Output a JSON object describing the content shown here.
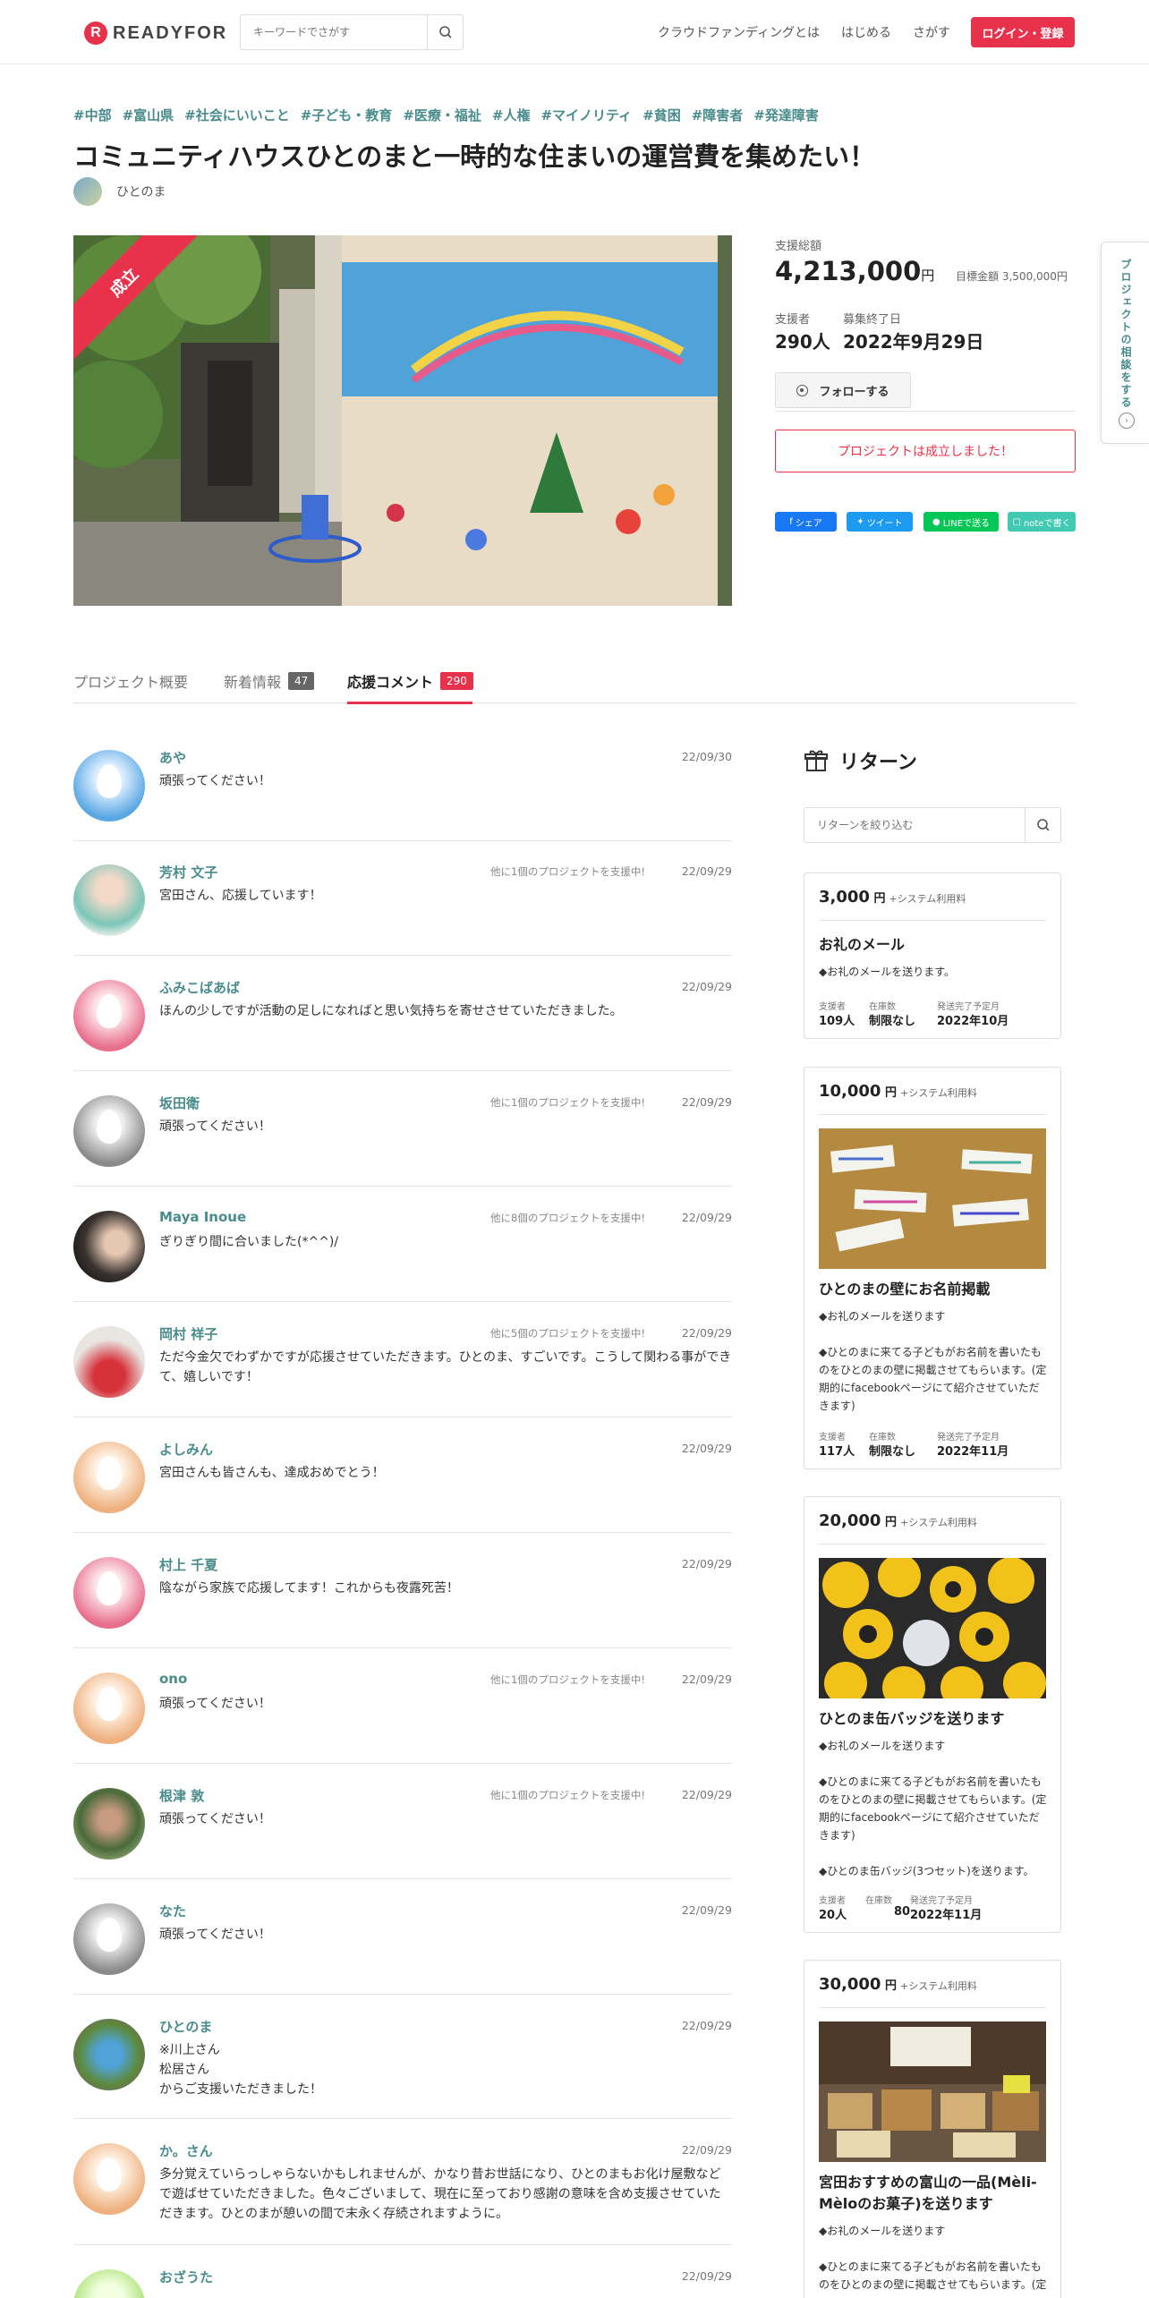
{
  "header": {
    "logo_text": "READYFOR",
    "search_placeholder": "キーワードでさがす",
    "nav": [
      "クラウドファンディングとは",
      "はじめる",
      "さがす"
    ],
    "login_label": "ログイン・登録"
  },
  "project": {
    "tags": [
      "#中部",
      "#富山県",
      "#社会にいいこと",
      "#子ども・教育",
      "#医療・福祉",
      "#人権",
      "#マイノリティ",
      "#貧困",
      "#障害者",
      "#発達障害"
    ],
    "title": "コミュニティハウスひとのまと一時的な住まいの運営費を集めたい！",
    "owner": "ひとのま",
    "ribbon": "成立"
  },
  "stats": {
    "total_label": "支援総額",
    "total_value": "4,213,000",
    "total_unit": "円",
    "goal_label": "目標金額",
    "goal_value": "3,500,000円",
    "supporters_label": "支援者",
    "supporters_value": "290人",
    "end_label": "募集終了日",
    "end_value": "2022年9月29日",
    "follow_label": "フォローする",
    "success_label": "プロジェクトは成立しました！",
    "share": [
      "シェア",
      "ツイート",
      "LINEで送る",
      "noteで書く"
    ]
  },
  "side_tab": {
    "label": "プロジェクトの相談をする"
  },
  "tabs": [
    {
      "label": "プロジェクト概要",
      "count": ""
    },
    {
      "label": "新着情報",
      "count": "47"
    },
    {
      "label": "応援コメント",
      "count": "290"
    }
  ],
  "comments": [
    {
      "name": "あや",
      "other": "",
      "date": "22/09/30",
      "text": "頑張ってください！"
    },
    {
      "name": "芳村 文子",
      "other": "他に1個のプロジェクトを支援中!",
      "date": "22/09/29",
      "text": "宮田さん、応援しています！"
    },
    {
      "name": "ふみこばあば",
      "other": "",
      "date": "22/09/29",
      "text": "ほんの少しですが活動の足しになればと思い気持ちを寄せさせていただきました。"
    },
    {
      "name": "坂田衛",
      "other": "他に1個のプロジェクトを支援中!",
      "date": "22/09/29",
      "text": "頑張ってください！"
    },
    {
      "name": "Maya Inoue",
      "other": "他に8個のプロジェクトを支援中!",
      "date": "22/09/29",
      "text": "ぎりぎり間に合いました(*^^)/"
    },
    {
      "name": "岡村 祥子",
      "other": "他に5個のプロジェクトを支援中!",
      "date": "22/09/29",
      "text": "ただ今金欠でわずかですが応援させていただきます。ひとのま、すごいです。こうして関わる事ができて、嬉しいです！"
    },
    {
      "name": "よしみん",
      "other": "",
      "date": "22/09/29",
      "text": "宮田さんも皆さんも、達成おめでとう！"
    },
    {
      "name": "村上 千夏",
      "other": "",
      "date": "22/09/29",
      "text": "陰ながら家族で応援してます！これからも夜露死苦！"
    },
    {
      "name": "ono",
      "other": "他に1個のプロジェクトを支援中!",
      "date": "22/09/29",
      "text": "頑張ってください！"
    },
    {
      "name": "根津 敦",
      "other": "他に1個のプロジェクトを支援中!",
      "date": "22/09/29",
      "text": "頑張ってください！"
    },
    {
      "name": "なた",
      "other": "",
      "date": "22/09/29",
      "text": "頑張ってください！"
    },
    {
      "name": "ひとのま",
      "other": "",
      "date": "22/09/29",
      "text": "※川上さん\n松居さん\nからご支援いただきました！"
    },
    {
      "name": "か。さん",
      "other": "",
      "date": "22/09/29",
      "text": "多分覚えていらっしゃらないかもしれませんが、かなり昔お世話になり、ひとのまもお化け屋敷などで遊ばせていただきました。色々ございまして、現在に至っており感謝の意味を含め支援させていただきます。ひとのまが憩いの間で末永く存続されますように。"
    },
    {
      "name": "おざうた",
      "other": "",
      "date": "22/09/29",
      "text": ""
    }
  ],
  "returns": {
    "heading": "リターン",
    "search_placeholder": "リターンを絞り込む",
    "fee_label": "+システム利用料",
    "meta_labels": [
      "支援者",
      "在庫数",
      "発送完了予定月"
    ],
    "cards": [
      {
        "price": "3,000",
        "title": "お礼のメール",
        "desc": "◆お礼のメールを送ります。",
        "supporters": "109人",
        "stock": "制限なし",
        "ship": "2022年10月"
      },
      {
        "price": "10,000",
        "title": "ひとのまの壁にお名前掲載",
        "desc": "◆お礼のメールを送ります\n\n◆ひとのまに来てる子どもがお名前を書いたものをひとのまの壁に掲載させてもらいます。(定期的にfacebookページにて紹介させていただきます)",
        "supporters": "117人",
        "stock": "制限なし",
        "ship": "2022年11月"
      },
      {
        "price": "20,000",
        "title": "ひとのま缶バッジを送ります",
        "desc": "◆お礼のメールを送ります\n\n◆ひとのまに来てる子どもがお名前を書いたものをひとのまの壁に掲載させてもらいます。(定期的にfacebookページにて紹介させていただきます)\n\n◆ひとのま缶バッジ(3つセット)を送ります。",
        "supporters": "20人",
        "stock": "80",
        "ship": "2022年11月"
      },
      {
        "price": "30,000",
        "title": "宮田おすすめの富山の一品(Mèli-Mèloのお菓子)を送ります",
        "desc": "◆お礼のメールを送ります\n\n◆ひとのまに来てる子どもがお名前を書いたものをひとのまの壁に掲載させてもらいます。(定",
        "supporters": "",
        "stock": "",
        "ship": ""
      }
    ]
  },
  "colors": {
    "accent": "#e8324b",
    "teal": "#4a8c8c"
  }
}
